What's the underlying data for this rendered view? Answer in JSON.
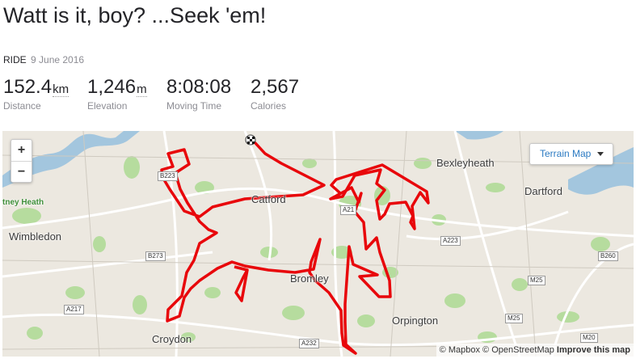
{
  "activity": {
    "title": "Watt is it, boy? ...Seek 'em!",
    "type": "RIDE",
    "date": "9 June 2016"
  },
  "stats": [
    {
      "value": "152.4",
      "unit": "km",
      "label": "Distance"
    },
    {
      "value": "1,246",
      "unit": "m",
      "label": "Elevation"
    },
    {
      "value": "8:08:08",
      "unit": "",
      "label": "Moving Time"
    },
    {
      "value": "2,567",
      "unit": "",
      "label": "Calories"
    }
  ],
  "map": {
    "zoom_in": "+",
    "zoom_out": "−",
    "terrain_button": "Terrain Map",
    "attribution": {
      "mapbox": "© Mapbox",
      "osm": "© OpenStreetMap",
      "improve": "Improve this map"
    },
    "places": {
      "bexleyheath": "Bexleyheath",
      "dartford": "Dartford",
      "catford": "Catford",
      "putney_heath": "tney Heath",
      "wimbledon": "Wimbledon",
      "bromley": "Bromley",
      "orpington": "Orpington",
      "croydon": "Croydon"
    },
    "roads": {
      "b223": "B223",
      "a21": "A21",
      "a223": "A223",
      "b273": "B273",
      "b260": "B260",
      "m25a": "M25",
      "m25b": "M25",
      "a217": "A217",
      "a232": "A232",
      "m20": "M20"
    },
    "route_color": "#e8070b",
    "water_color": "#a3c6de",
    "park_color": "#b6dc9e"
  }
}
